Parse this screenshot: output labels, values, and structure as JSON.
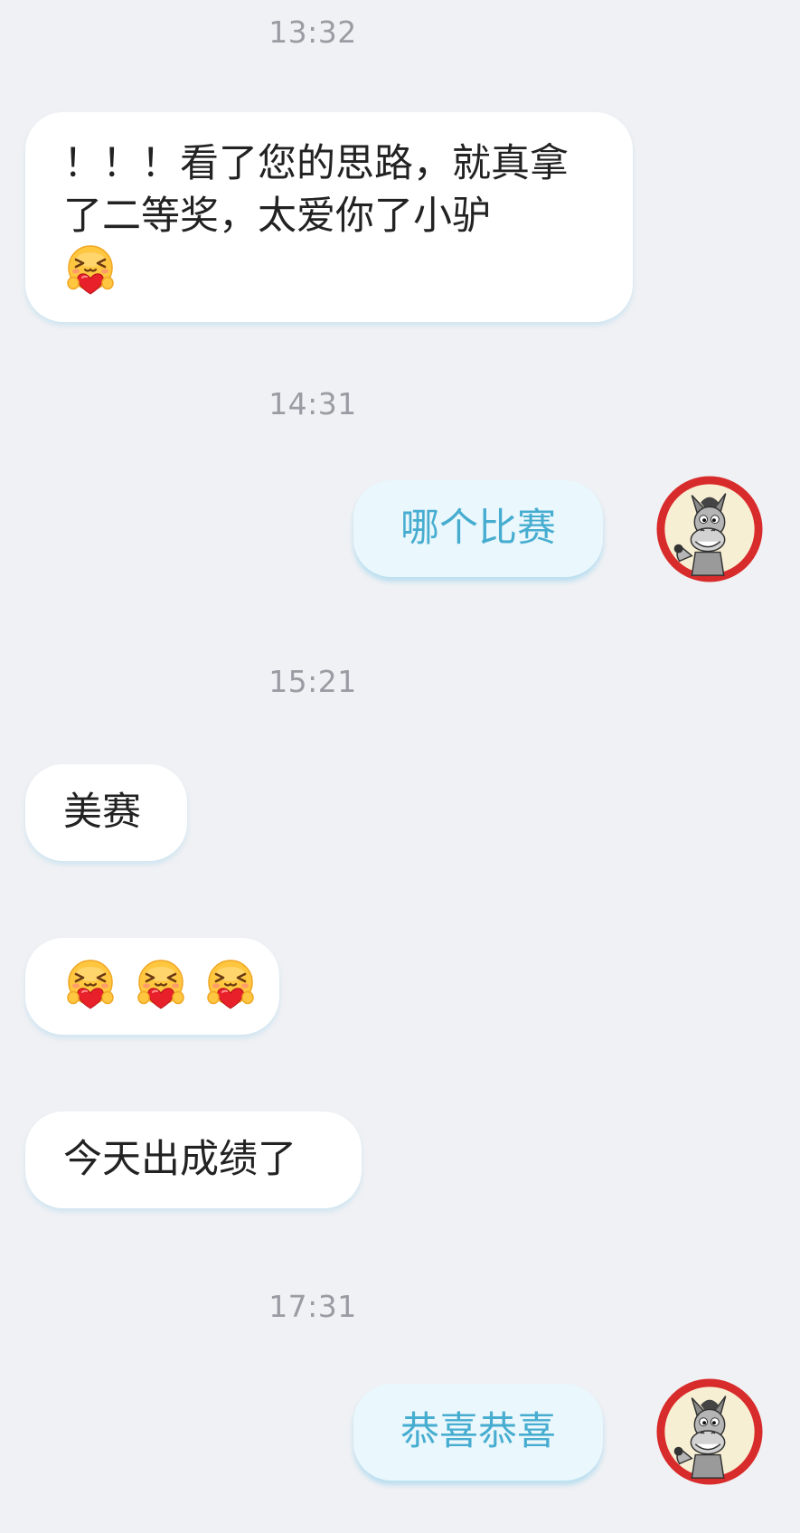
{
  "conversation": {
    "timestamps": [
      "13:32",
      "14:31",
      "15:21",
      "17:31"
    ],
    "msg1": {
      "text": "！！！看了您的思路，就真拿了二等奖，太爱你了小驴",
      "emoji": "heart-hug-emoji"
    },
    "msg2": {
      "text": "哪个比赛"
    },
    "msg3": {
      "text": "美赛"
    },
    "msg4": {
      "emoji_count": 3,
      "emoji": "heart-hug-emoji"
    },
    "msg5": {
      "text": "今天出成绩了"
    },
    "msg6": {
      "text": "恭喜恭喜"
    }
  },
  "colors": {
    "background": "#f0f1f4",
    "incoming_bubble": "#ffffff",
    "outgoing_bubble": "#eaf7fc",
    "outgoing_text": "#47add0",
    "timestamp": "#9a9ca3"
  }
}
